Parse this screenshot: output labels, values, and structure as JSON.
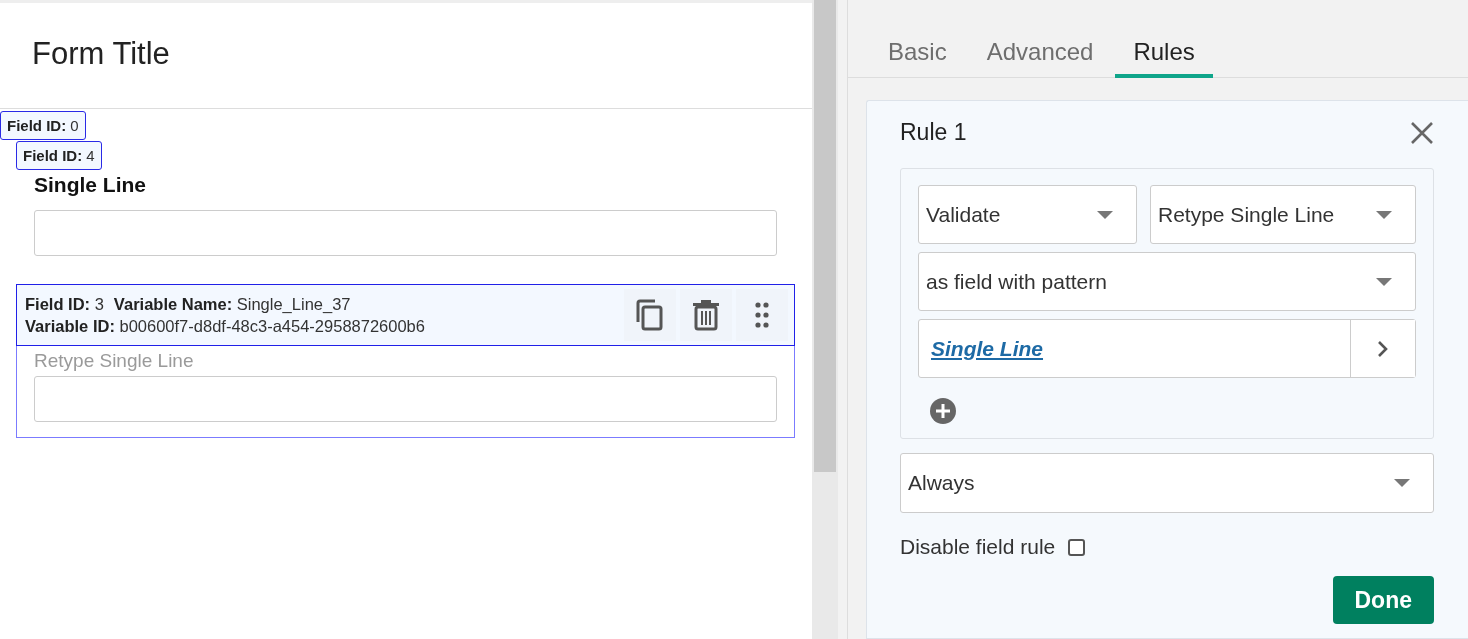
{
  "form": {
    "title": "Form Title",
    "id_badges": [
      {
        "label": "Field ID:",
        "value": "0"
      },
      {
        "label": "Field ID:",
        "value": "4"
      }
    ],
    "fields": [
      {
        "label": "Single Line",
        "selected": false
      },
      {
        "label": "Retype Single Line",
        "selected": true
      }
    ],
    "selection_info": [
      [
        {
          "label": "Field ID:",
          "value": "3"
        },
        {
          "label": "Variable Name:",
          "value": "Single_Line_37"
        }
      ],
      [
        {
          "label": "Variable ID:",
          "value": "b00600f7-d8df-48c3-a454-2958872600b6"
        }
      ]
    ]
  },
  "tabs": [
    {
      "label": "Basic",
      "selected": false
    },
    {
      "label": "Advanced",
      "selected": false
    },
    {
      "label": "Rules",
      "selected": true
    }
  ],
  "rule": {
    "title": "Rule 1",
    "action_selects": [
      "Validate",
      "Retype Single Line"
    ],
    "operator_select": "as field with pattern",
    "field_link": "Single Line",
    "trigger_select": "Always",
    "disable": {
      "label": "Disable field rule",
      "checked": false
    },
    "done_button": "Done"
  }
}
